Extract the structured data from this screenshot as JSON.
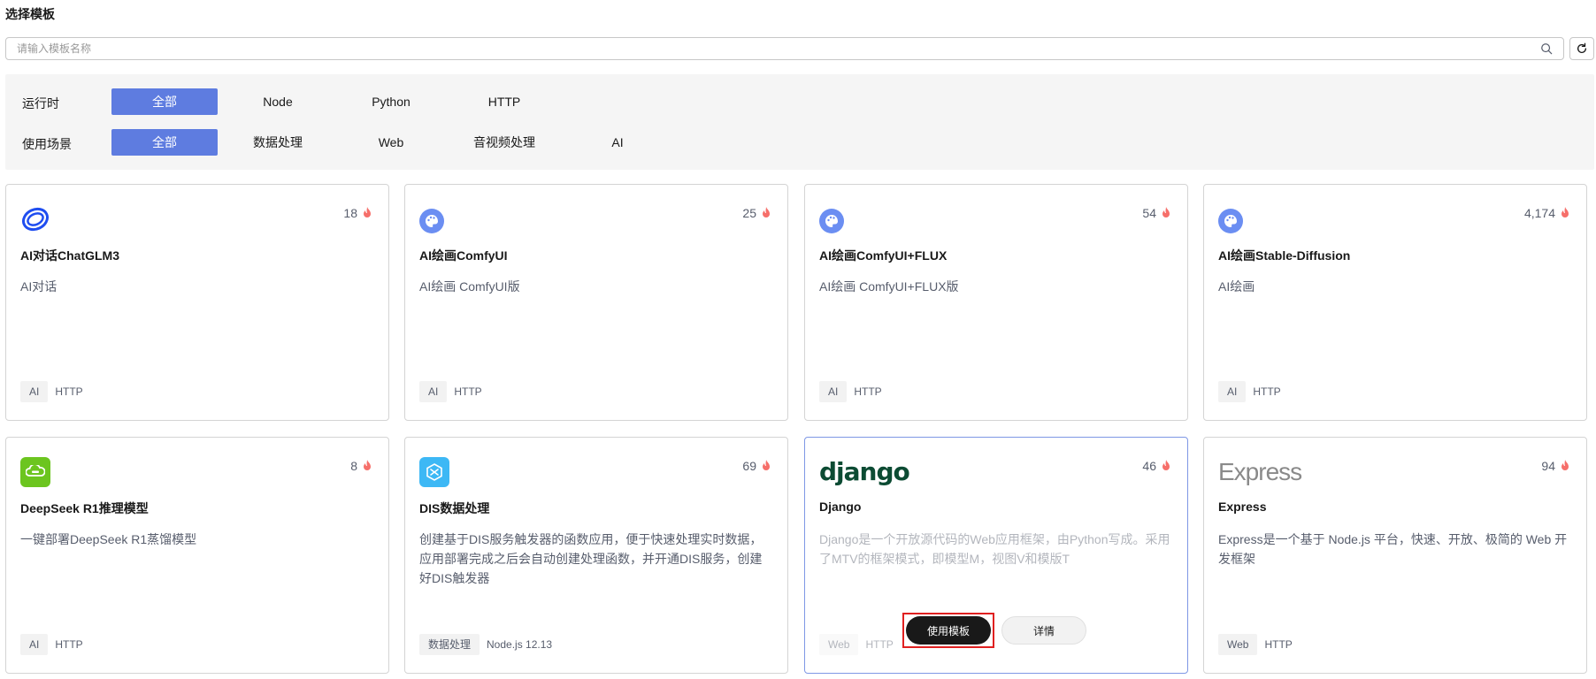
{
  "page": {
    "title": "选择模板"
  },
  "search": {
    "placeholder": "请输入模板名称",
    "value": ""
  },
  "filters": {
    "runtime": {
      "label": "运行时",
      "options": [
        "全部",
        "Node",
        "Python",
        "HTTP"
      ],
      "selected": "全部"
    },
    "scenario": {
      "label": "使用场景",
      "options": [
        "全部",
        "数据处理",
        "Web",
        "音视频处理",
        "AI"
      ],
      "selected": "全部"
    }
  },
  "colors": {
    "accent": "#5e7ce0",
    "fire": "#f66f6a",
    "highlight_border": "#e02020"
  },
  "cards": [
    {
      "icon": "chatglm-logo-icon",
      "count": "18",
      "title": "AI对话ChatGLM3",
      "desc": "AI对话",
      "tag1": "AI",
      "tag2": "HTTP"
    },
    {
      "icon": "palette-logo-icon",
      "count": "25",
      "title": "AI绘画ComfyUI",
      "desc": "AI绘画 ComfyUI版",
      "tag1": "AI",
      "tag2": "HTTP"
    },
    {
      "icon": "palette-logo-icon",
      "count": "54",
      "title": "AI绘画ComfyUI+FLUX",
      "desc": "AI绘画 ComfyUI+FLUX版",
      "tag1": "AI",
      "tag2": "HTTP"
    },
    {
      "icon": "palette-logo-icon",
      "count": "4,174",
      "title": "AI绘画Stable-Diffusion",
      "desc": "AI绘画",
      "tag1": "AI",
      "tag2": "HTTP"
    },
    {
      "icon": "deepseek-logo-icon",
      "count": "8",
      "title": "DeepSeek R1推理模型",
      "desc": "一键部署DeepSeek R1蒸馏模型",
      "tag1": "AI",
      "tag2": "HTTP"
    },
    {
      "icon": "dis-logo-icon",
      "count": "69",
      "title": "DIS数据处理",
      "desc": "创建基于DIS服务触发器的函数应用，便于快速处理实时数据，应用部署完成之后会自动创建处理函数，并开通DIS服务，创建好DIS触发器",
      "tag1": "数据处理",
      "tag2": "Node.js 12.13"
    },
    {
      "icon": "django-logo-icon",
      "logo_text": "django",
      "count": "46",
      "title": "Django",
      "desc": "Django是一个开放源代码的Web应用框架，由Python写成。采用了MTV的框架模式，即模型M，视图V和模版T",
      "tag1": "Web",
      "tag2": "HTTP",
      "use_label": "使用模板",
      "detail_label": "详情"
    },
    {
      "icon": "express-logo-icon",
      "logo_text": "Express",
      "count": "94",
      "title": "Express",
      "desc": "Express是一个基于 Node.js 平台，快速、开放、极简的 Web 开发框架",
      "tag1": "Web",
      "tag2": "HTTP"
    }
  ]
}
